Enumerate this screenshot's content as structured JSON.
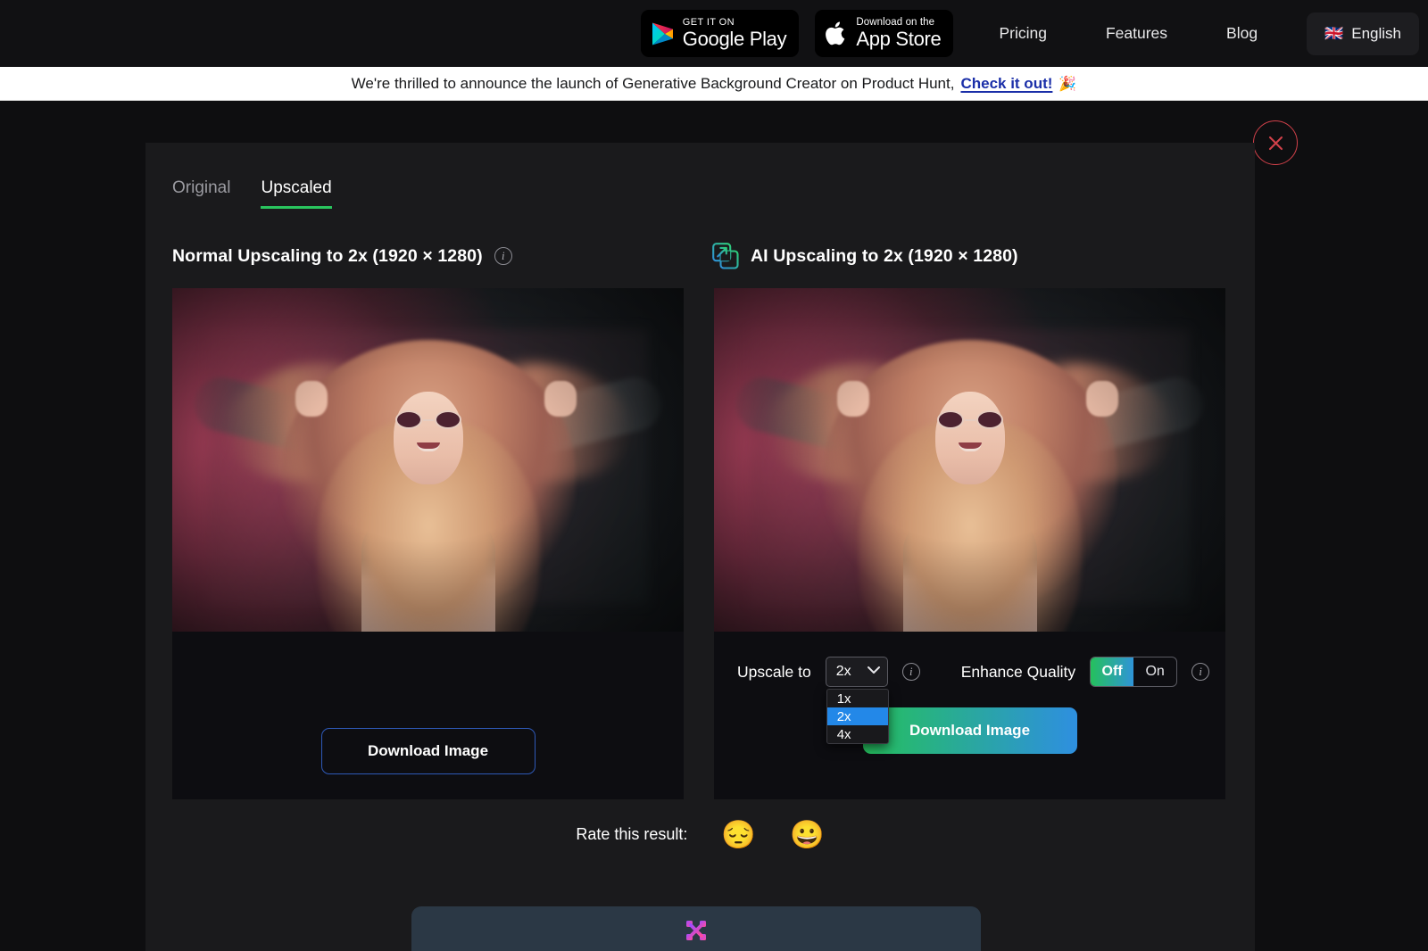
{
  "topnav": {
    "google_play": {
      "small": "GET IT ON",
      "big": "Google Play"
    },
    "app_store": {
      "small": "Download on the",
      "big": "App Store"
    },
    "links": [
      {
        "label": "Pricing"
      },
      {
        "label": "Features"
      },
      {
        "label": "Blog"
      }
    ],
    "language": {
      "flag": "🇬🇧",
      "label": "English"
    }
  },
  "banner": {
    "message": "We're thrilled to announce the launch of Generative Background Creator on Product Hunt,",
    "cta": "Check it out!",
    "emoji": "🎉"
  },
  "modal": {
    "close_label": "×",
    "tabs": [
      {
        "label": "Original",
        "active": false
      },
      {
        "label": "Upscaled",
        "active": true
      }
    ],
    "left_panel": {
      "heading": "Normal Upscaling to 2x (1920 × 1280)",
      "info": "i",
      "download_label": "Download Image"
    },
    "right_panel": {
      "heading": "AI Upscaling to 2x (1920 × 1280)",
      "icon": "ai-upscale-icon",
      "info": "i",
      "download_label": "Download Image",
      "upscale_label": "Upscale to",
      "upscale_value": "2x",
      "upscale_options": [
        {
          "label": "1x",
          "selected": false
        },
        {
          "label": "2x",
          "selected": true
        },
        {
          "label": "4x",
          "selected": false
        }
      ],
      "enhance_label": "Enhance Quality",
      "enhance_off": "Off",
      "enhance_on": "On",
      "enhance_state": "Off"
    },
    "rate": {
      "label": "Rate this result:",
      "sad_emoji": "😔",
      "happy_emoji": "😀"
    }
  },
  "colors": {
    "accent_green": "#29c55e",
    "accent_blue": "#2e8fe0",
    "close_red": "#d2414a",
    "banner_link": "#1a2ea8",
    "dropdown_highlight": "#2388e8"
  }
}
